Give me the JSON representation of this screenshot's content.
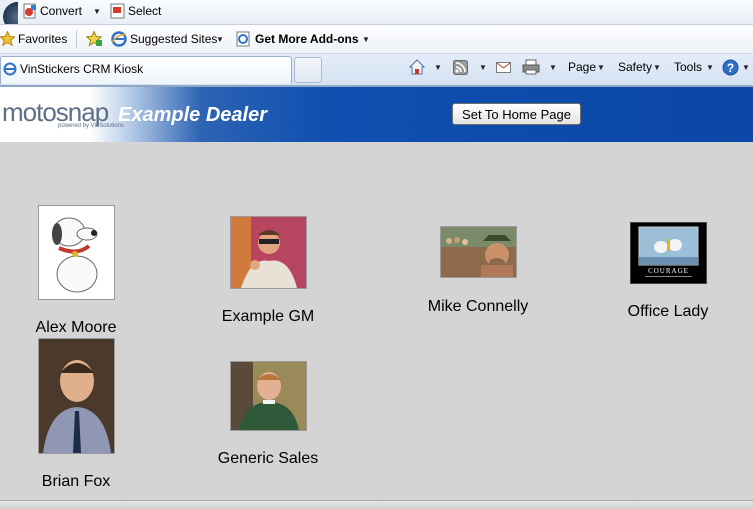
{
  "toolbar": {
    "convert_label": "Convert",
    "select_label": "Select"
  },
  "favorites_bar": {
    "favorites_label": "Favorites",
    "suggested_label": "Suggested Sites",
    "addons_label": "Get More Add-ons"
  },
  "tab": {
    "title": "VinStickers CRM Kiosk"
  },
  "commands": {
    "page_label": "Page",
    "safety_label": "Safety",
    "tools_label": "Tools"
  },
  "header": {
    "logo_text": "motosnap",
    "logo_sub": "powered by VinSolutions",
    "dealer_name": "Example Dealer",
    "home_button": "Set To Home Page"
  },
  "people": [
    {
      "name": "Alex Moore"
    },
    {
      "name": "Example GM"
    },
    {
      "name": "Mike Connelly"
    },
    {
      "name": "Office Lady",
      "poster_caption": "COURAGE"
    },
    {
      "name": "Brian Fox"
    },
    {
      "name": "Generic Sales"
    }
  ],
  "colors": {
    "banner_blue": "#0b47a6",
    "page_bg": "#d4d4d4"
  }
}
